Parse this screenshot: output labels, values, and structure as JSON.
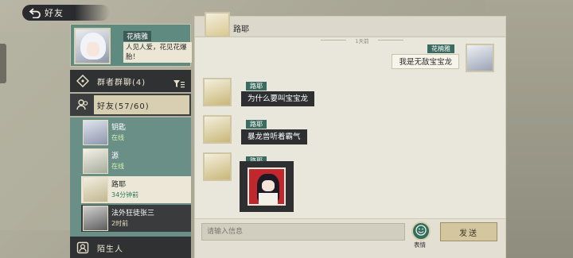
{
  "header": {
    "title": "好友"
  },
  "me": {
    "name": "花楠雅",
    "signature": "人见人爱，花见花爆胎！"
  },
  "nav": {
    "group_label": "群者群聊(4)",
    "friends_label": "好友(57/60)",
    "stranger_label": "陌生人"
  },
  "friends": [
    {
      "name": "钥匙",
      "status": "在线"
    },
    {
      "name": "源",
      "status": "在线"
    },
    {
      "name": "路耶",
      "status": "34分钟前"
    },
    {
      "name": "法外狂徒张三",
      "status": "2时前"
    }
  ],
  "chat": {
    "title": "路耶",
    "time_separator": "1天前",
    "messages": [
      {
        "sender": "花楠雅",
        "text": "我是无敌宝宝龙"
      },
      {
        "sender": "路耶",
        "text": "为什么要叫宝宝龙"
      },
      {
        "sender": "路耶",
        "text": "暴龙兽听着霸气"
      },
      {
        "sender": "路耶",
        "text": ""
      }
    ],
    "input_placeholder": "请输入信息",
    "emoji_label": "表情",
    "send_label": "发送"
  },
  "colors": {
    "accent": "#3b6a5e",
    "bubble_dark": "#2d2f30",
    "send_button": "#d4c79f"
  },
  "icons": [
    "back-icon",
    "dice-icon",
    "filter-icon",
    "friends-icon",
    "stranger-icon",
    "emoji-icon"
  ]
}
